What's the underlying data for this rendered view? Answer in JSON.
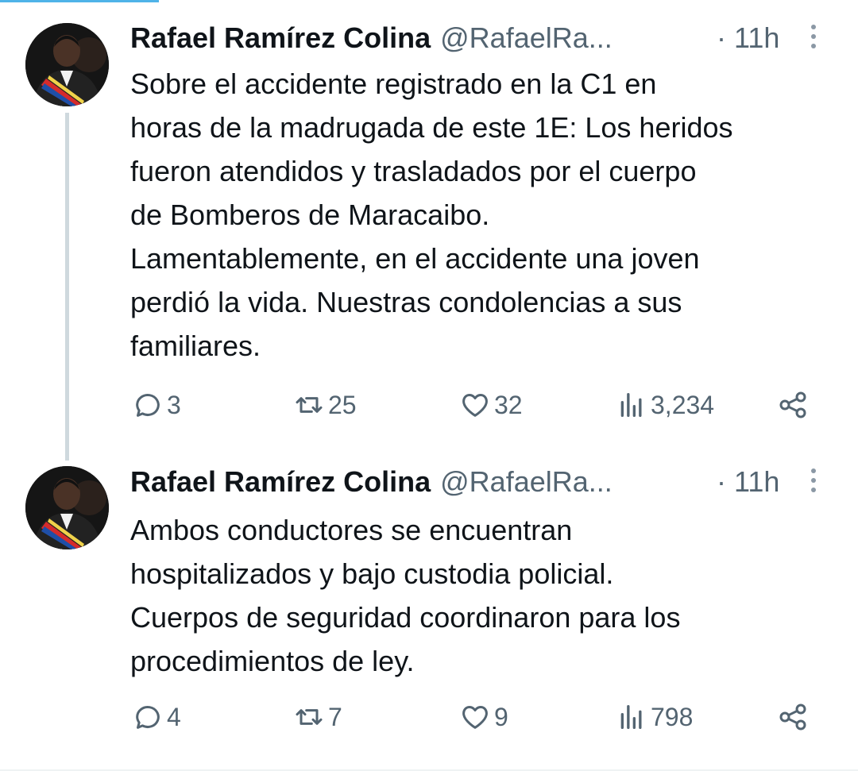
{
  "tweets": [
    {
      "name": "Rafael Ramírez Colina",
      "handle": "@RafaelRa...",
      "dot": "·",
      "time": "11h",
      "text": "Sobre el accidente registrado en la C1 en\nhoras de la madrugada de este 1E: Los heridos\nfueron atendidos y trasladados por el cuerpo\nde Bomberos de Maracaibo.\nLamentablemente, en el accidente una joven\nperdió la vida. Nuestras condolencias a sus\nfamiliares.",
      "replies": "3",
      "retweets": "25",
      "likes": "32",
      "views": "3,234"
    },
    {
      "name": "Rafael Ramírez Colina",
      "handle": "@RafaelRa...",
      "dot": "·",
      "time": "11h",
      "text": "Ambos conductores se encuentran\nhospitalizados y bajo custodia policial.\nCuerpos de seguridad coordinaron para los\nprocedimientos de ley.",
      "replies": "4",
      "retweets": "7",
      "likes": "9",
      "views": "798"
    }
  ],
  "icons": {
    "reply": "reply-icon",
    "retweet": "retweet-icon",
    "like": "heart-icon",
    "views": "views-icon",
    "share": "share-icon",
    "more": "more-icon"
  },
  "colors": {
    "text": "#0f1419",
    "secondary": "#536471",
    "thread_line": "#cfd9de",
    "top_accent": "#4fb3e8"
  }
}
